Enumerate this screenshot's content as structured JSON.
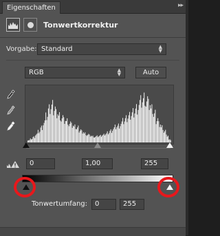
{
  "tab": {
    "label": "Eigenschaften"
  },
  "collapse_icon": "double-chevron-right-icon",
  "header": {
    "title": "Tonwertkorrektur",
    "icons": [
      "levels-adjustment-icon",
      "layer-mask-icon"
    ]
  },
  "preset": {
    "label": "Vorgabe:",
    "value": "Standard"
  },
  "channel": {
    "value": "RGB"
  },
  "auto_button": {
    "label": "Auto"
  },
  "eyedroppers": [
    "black-point-eyedropper-icon",
    "gray-point-eyedropper-icon",
    "white-point-eyedropper-icon"
  ],
  "input_levels": {
    "black": "0",
    "gamma": "1,00",
    "white": "255"
  },
  "output_levels": {
    "label": "Tonwertumfang:",
    "black": "0",
    "white": "255"
  },
  "colors": {
    "panel_bg": "#535353",
    "highlight_ring": "#e8181c"
  },
  "chart_data": {
    "type": "histogram",
    "channel": "RGB",
    "x_range": [
      0,
      255
    ],
    "bins_note": "luminance distribution, relative heights",
    "values": [
      0.05,
      0.08,
      0.12,
      0.18,
      0.24,
      0.32,
      0.42,
      0.55,
      0.7,
      0.78,
      0.74,
      0.66,
      0.6,
      0.54,
      0.48,
      0.46,
      0.4,
      0.36,
      0.33,
      0.31,
      0.27,
      0.24,
      0.2,
      0.17,
      0.15,
      0.13,
      0.12,
      0.13,
      0.14,
      0.16,
      0.19,
      0.22,
      0.26,
      0.3,
      0.34,
      0.36,
      0.4,
      0.45,
      0.5,
      0.56,
      0.62,
      0.68,
      0.76,
      0.84,
      0.9,
      0.95,
      0.88,
      0.8,
      0.7,
      0.6,
      0.5,
      0.42,
      0.34,
      0.25,
      0.15,
      0.06
    ]
  }
}
